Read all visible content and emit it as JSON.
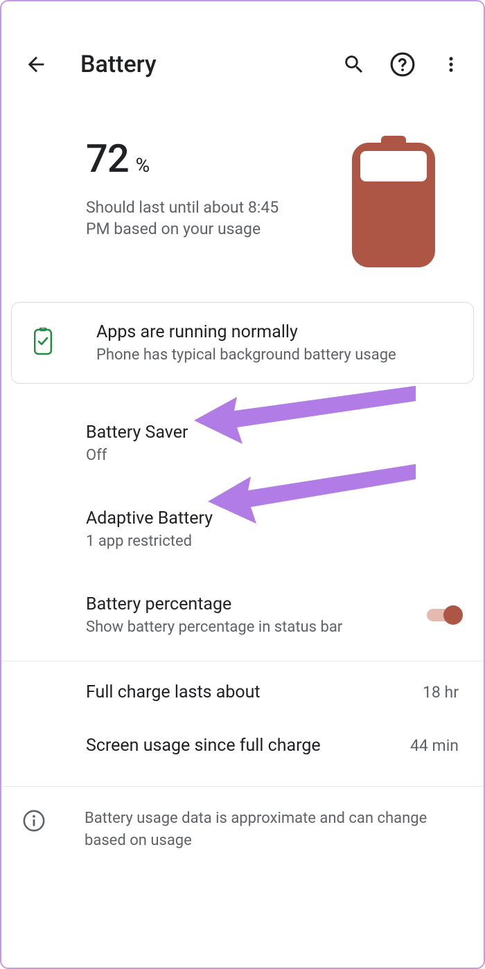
{
  "header": {
    "title": "Battery"
  },
  "summary": {
    "percent": "72",
    "percent_symbol": "%",
    "estimate": "Should last until about 8:45 PM based on your usage"
  },
  "status_card": {
    "title": "Apps are running normally",
    "subtitle": "Phone has typical background battery usage"
  },
  "items": {
    "battery_saver": {
      "title": "Battery Saver",
      "subtitle": "Off"
    },
    "adaptive": {
      "title": "Adaptive Battery",
      "subtitle": "1 app restricted"
    },
    "percentage": {
      "title": "Battery percentage",
      "subtitle": "Show battery percentage in status bar",
      "toggle_on": true
    }
  },
  "stats": {
    "full_charge": {
      "label": "Full charge lasts about",
      "value": "18 hr"
    },
    "screen_usage": {
      "label": "Screen usage since full charge",
      "value": "44 min"
    }
  },
  "footer_note": "Battery usage data is approximate and can change based on usage",
  "colors": {
    "accent": "#ad5646",
    "arrow": "#b27ce6"
  }
}
